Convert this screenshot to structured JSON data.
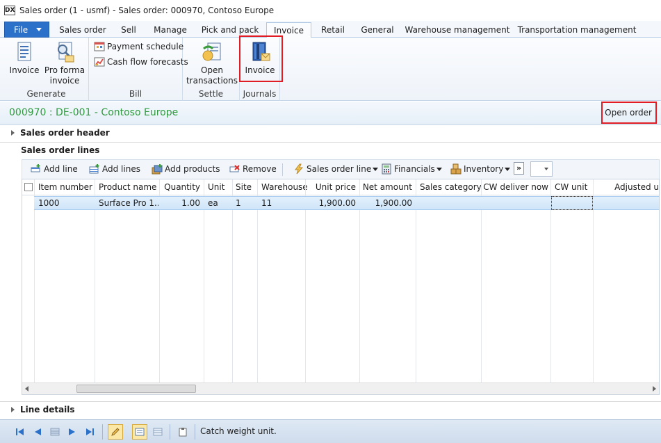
{
  "window": {
    "title": "Sales order (1 - usmf) - Sales order: 000970, Contoso Europe",
    "icon_text": "DX"
  },
  "tabs": {
    "file": "File",
    "items": [
      {
        "label": "Sales order"
      },
      {
        "label": "Sell"
      },
      {
        "label": "Manage"
      },
      {
        "label": "Pick and pack"
      },
      {
        "label": "Invoice",
        "active": true
      },
      {
        "label": "Retail"
      },
      {
        "label": "General"
      },
      {
        "label": "Warehouse management"
      },
      {
        "label": "Transportation management"
      }
    ]
  },
  "ribbon": {
    "generate": {
      "label": "Generate",
      "invoice": "Invoice",
      "pro_forma_line1": "Pro forma",
      "pro_forma_line2": "invoice"
    },
    "bill": {
      "label": "Bill",
      "payment_schedule": "Payment schedule",
      "cash_flow": "Cash flow forecasts"
    },
    "settle": {
      "label": "Settle",
      "open_line1": "Open",
      "open_line2": "transactions"
    },
    "journals": {
      "label": "Journals",
      "invoice": "Invoice"
    }
  },
  "banner": {
    "title": "000970 : DE-001 - Contoso Europe",
    "status": "Open order"
  },
  "sections": {
    "header": "Sales order header",
    "lines": "Sales order lines",
    "details": "Line details"
  },
  "grid_toolbar": {
    "add_line": "Add line",
    "add_lines": "Add lines",
    "add_products": "Add products",
    "remove": "Remove",
    "sales_order_line": "Sales order line",
    "financials": "Financials",
    "inventory": "Inventory",
    "more": "»"
  },
  "grid": {
    "columns": [
      "Item number",
      "Product name",
      "Quantity",
      "Unit",
      "Site",
      "Warehouse",
      "Unit price",
      "Net amount",
      "Sales category",
      "CW deliver now",
      "CW unit",
      "Adjusted u"
    ],
    "rows": [
      [
        "1000",
        "Surface Pro 1...",
        "1.00",
        "ea",
        "1",
        "11",
        "1,900.00",
        "1,900.00",
        "",
        "",
        "",
        ""
      ]
    ]
  },
  "statusbar": {
    "text": "Catch weight unit."
  },
  "colors": {
    "accent_blue": "#2b70c9",
    "banner_green": "#2f9b3e",
    "highlight_red": "#e01c24"
  }
}
